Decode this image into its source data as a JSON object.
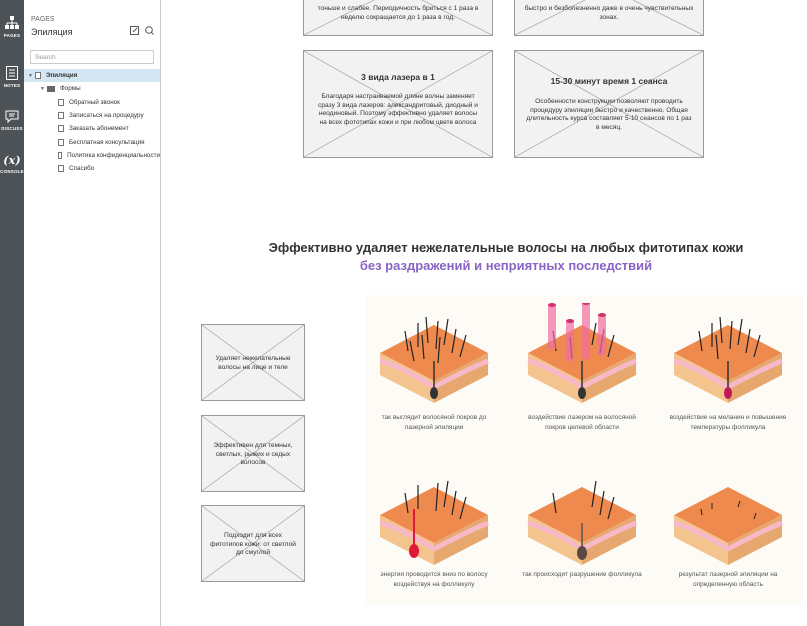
{
  "rail": [
    {
      "label": "PAGES",
      "icon": "sitemap-icon"
    },
    {
      "label": "NOTES",
      "icon": "notes-icon"
    },
    {
      "label": "DISCUSS",
      "icon": "discuss-icon"
    },
    {
      "label": "CONSOLE",
      "icon": "console-icon"
    }
  ],
  "panel": {
    "header": "PAGES",
    "title": "Эпиляция",
    "search_placeholder": "Search",
    "tree": [
      {
        "label": "Эпиляция",
        "level": 0
      },
      {
        "label": "Формы",
        "level": 1
      },
      {
        "label": "Обратный звонок",
        "level": 2
      },
      {
        "label": "Записаться на процедуру",
        "level": 2
      },
      {
        "label": "Заказать абонемент",
        "level": 2
      },
      {
        "label": "Бесплатная консультация",
        "level": 2
      },
      {
        "label": "Политика конфиденциальности",
        "level": 2
      },
      {
        "label": "Спасибо",
        "level": 2
      }
    ]
  },
  "cards_top": [
    {
      "text": "тоньше и слабее. Периодичность бриться с 1 раза в неделю сокращается до 1 раза в год."
    },
    {
      "text": "быстро и безболезненно даже в очень чувствительных зонах."
    }
  ],
  "cards_mid": [
    {
      "heading": "3 вида лазера в 1",
      "text": "Благодаря настраиваемой длине волны заменяет сразу 3 вида лазеров: александритовый, диодный и неодиновый. Поэтому эффективно удаляет волосы на всех фототипах кожи и при любом цвете волоса"
    },
    {
      "heading": "15-30 минут время 1 сеанса",
      "text": "Особенности конструкции позволяют проводить процедуру эпиляции быстро и качественно. Общая длительность курса составляет 5-10 сеансов по 1 раз в месяц."
    }
  ],
  "section": {
    "title": "Эффективно удаляет нежелательные волосы на любых фитотипах кожи",
    "subtitle": "без раздражений и неприятных последствий"
  },
  "side_boxes": [
    {
      "text": "Удаляет нежелательные волосы на лице и теле"
    },
    {
      "text": "Эффективен для темных, светлых, рыжих и седых волосов"
    },
    {
      "text": "Подходит для всех фитотипов кожи: от светлой до смуглой"
    }
  ],
  "illustrations": [
    {
      "caption": "так выглядит волосяной покров до лазерной эпиляции"
    },
    {
      "caption": "воздействие лазером на волосяной покров целевой области"
    },
    {
      "caption": "воздействие на меланин и повышение температуры фолликула"
    },
    {
      "caption": "энергия проводится вниз по волосу воздействуя на фолликулу"
    },
    {
      "caption": "так происходит разрушение фолликула"
    },
    {
      "caption": "результат лазерной эпиляции на определенную область"
    }
  ],
  "colors": {
    "rail": "#4d5257",
    "accent": "#8a63c6",
    "selected": "#d5e6f3",
    "skin": "#e87a3f"
  }
}
